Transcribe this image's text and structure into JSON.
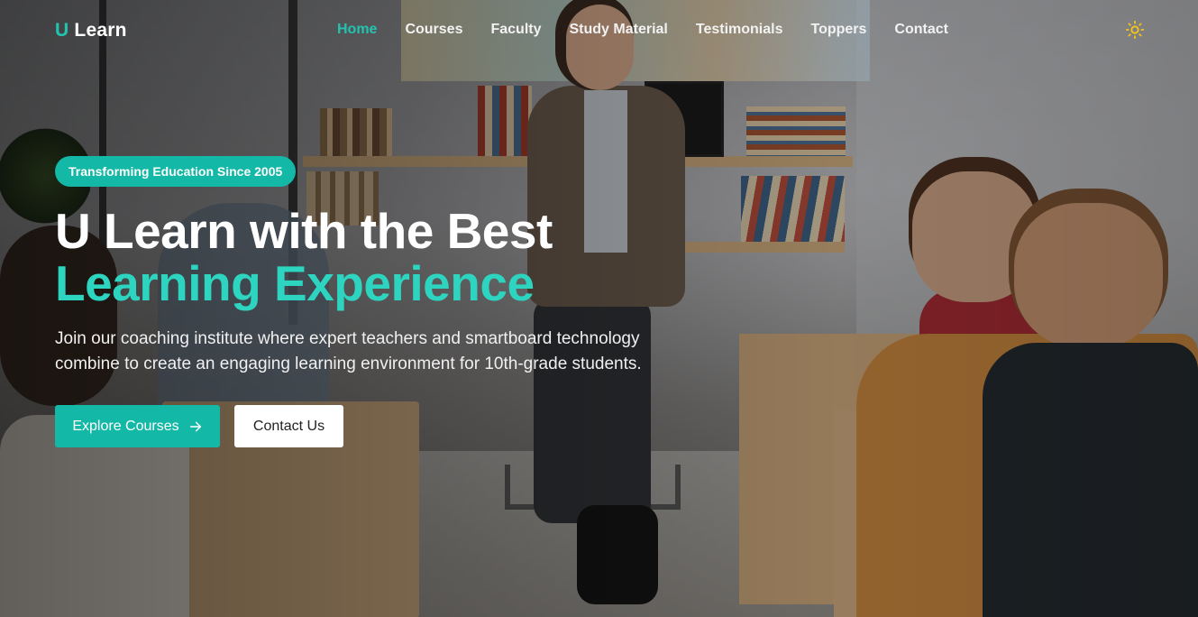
{
  "brand": {
    "prefix": "U",
    "name": "Learn"
  },
  "nav": {
    "items": [
      {
        "label": "Home",
        "active": true
      },
      {
        "label": "Courses",
        "active": false
      },
      {
        "label": "Faculty",
        "active": false
      },
      {
        "label": "Study Material",
        "active": false
      },
      {
        "label": "Testimonials",
        "active": false
      },
      {
        "label": "Toppers",
        "active": false
      },
      {
        "label": "Contact",
        "active": false
      }
    ],
    "theme_icon": "sun-icon"
  },
  "hero": {
    "badge": "Transforming Education Since 2005",
    "title_line1": "U Learn with the Best",
    "title_line2": "Learning Experience",
    "description": "Join our coaching institute where expert teachers and smartboard technology combine to create an engaging learning environment for 10th-grade students.",
    "primary_button": "Explore Courses",
    "primary_button_icon": "arrow-right-icon",
    "secondary_button": "Contact Us"
  },
  "colors": {
    "accent": "#14b8a6",
    "accent_text": "#2dd4bf",
    "theme_icon": "#f5c518"
  }
}
